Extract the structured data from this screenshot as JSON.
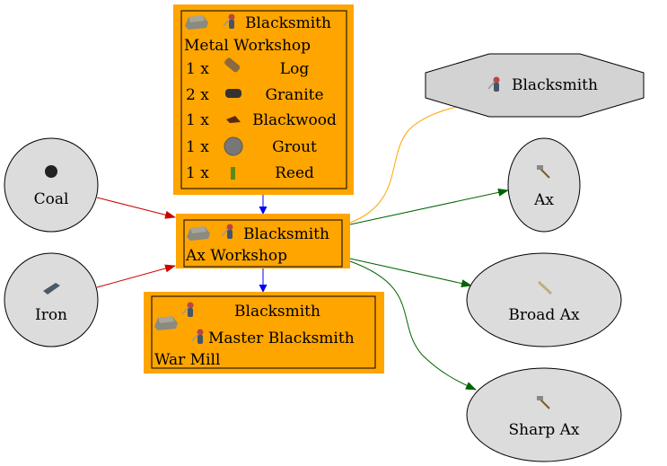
{
  "colors": {
    "node_fill": "#ffa500",
    "ellipse_fill": "#dcdcdc",
    "octagon_fill": "#d3d3d3",
    "input_edge": "#cc0000",
    "chain_edge": "#0000ff",
    "worker_edge": "#ffa500",
    "output_edge": "#006400"
  },
  "metal_workshop": {
    "worker": "Blacksmith",
    "name": "Metal Workshop",
    "costs": [
      {
        "qty": "1 x",
        "item": "Log",
        "icon": "log-icon"
      },
      {
        "qty": "2 x",
        "item": "Granite",
        "icon": "granite-icon"
      },
      {
        "qty": "1 x",
        "item": "Blackwood",
        "icon": "blackwood-icon"
      },
      {
        "qty": "1 x",
        "item": "Grout",
        "icon": "grout-icon"
      },
      {
        "qty": "1 x",
        "item": "Reed",
        "icon": "reed-icon"
      }
    ]
  },
  "ax_workshop": {
    "worker": "Blacksmith",
    "name": "Ax Workshop"
  },
  "war_mill": {
    "worker1": "Blacksmith",
    "worker2": "Master Blacksmith",
    "name": "War Mill"
  },
  "inputs": [
    {
      "label": "Coal",
      "icon": "coal-icon"
    },
    {
      "label": "Iron",
      "icon": "iron-icon"
    }
  ],
  "worker_node": {
    "label": "Blacksmith"
  },
  "outputs": [
    {
      "label": "Ax",
      "icon": "ax-icon"
    },
    {
      "label": "Broad Ax",
      "icon": "broad-ax-icon"
    },
    {
      "label": "Sharp Ax",
      "icon": "sharp-ax-icon"
    }
  ]
}
